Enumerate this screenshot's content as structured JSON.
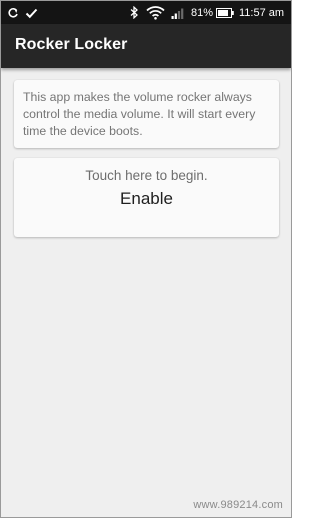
{
  "status_bar": {
    "battery_percent": "81%",
    "time": "11:57 am",
    "icons": [
      "sync-icon",
      "check-icon",
      "bluetooth-icon",
      "wifi-icon",
      "signal-icon",
      "battery-icon"
    ]
  },
  "app_bar": {
    "title": "Rocker Locker",
    "background": "#262626"
  },
  "info_card": {
    "text": "This app makes the volume rocker always control the media volume.  It will start every time the device boots."
  },
  "enable_card": {
    "hint": "Touch here to begin.",
    "button_label": "Enable"
  },
  "watermark": {
    "text": "www.989214.com"
  }
}
